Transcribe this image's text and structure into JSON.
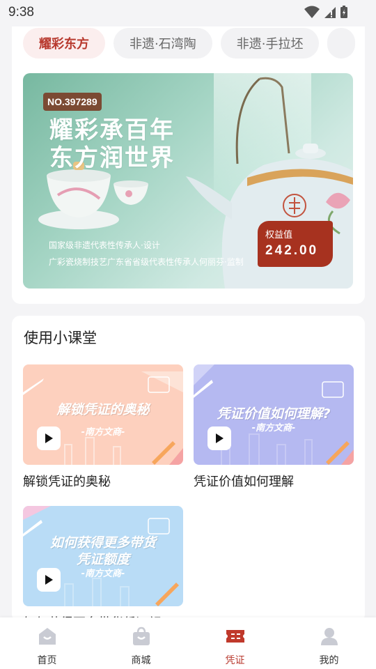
{
  "status_bar": {
    "time": "9:38"
  },
  "categories": [
    {
      "label": "耀彩东方",
      "active": true
    },
    {
      "label": "非遗·石湾陶",
      "active": false
    },
    {
      "label": "非遗·手拉坯",
      "active": false
    },
    {
      "label": "",
      "active": false
    }
  ],
  "banner": {
    "serial": "NO.397289",
    "title_line1": "耀彩承百年",
    "title_line2": "东方润世界",
    "subtitle_line1": "国家级非遗代表性传承人·设计",
    "subtitle_line2": "广彩瓷烧制技艺广东省省级代表性传承人何丽芬·监制",
    "value_label": "权益值",
    "value": "242.00"
  },
  "lessons": {
    "title": "使用小课堂",
    "items": [
      {
        "thumb_text": "解锁凭证的奥秘",
        "thumb_brand": "-南方文商-",
        "title": "解锁凭证的奥秘",
        "bg": "#fdd0be"
      },
      {
        "thumb_text": "凭证价值如何理解?",
        "thumb_brand": "-南方文商-",
        "title": "凭证价值如何理解",
        "bg": "#b5b9f1"
      },
      {
        "thumb_text_line1": "如何获得更多带货",
        "thumb_text_line2": "凭证额度",
        "thumb_brand": "-南方文商-",
        "title": "如何获得更多带货凭证额",
        "bg": "#b9dcf6"
      }
    ]
  },
  "tabbar": {
    "items": [
      {
        "label": "首页",
        "icon": "home-icon",
        "active": false
      },
      {
        "label": "商城",
        "icon": "shopping-bag-icon",
        "active": false
      },
      {
        "label": "凭证",
        "icon": "ticket-icon",
        "active": true
      },
      {
        "label": "我的",
        "icon": "user-icon",
        "active": false
      }
    ]
  },
  "colors": {
    "accent": "#b8392e",
    "value_box": "#a7321f",
    "serial_badge": "#7b4a33"
  }
}
